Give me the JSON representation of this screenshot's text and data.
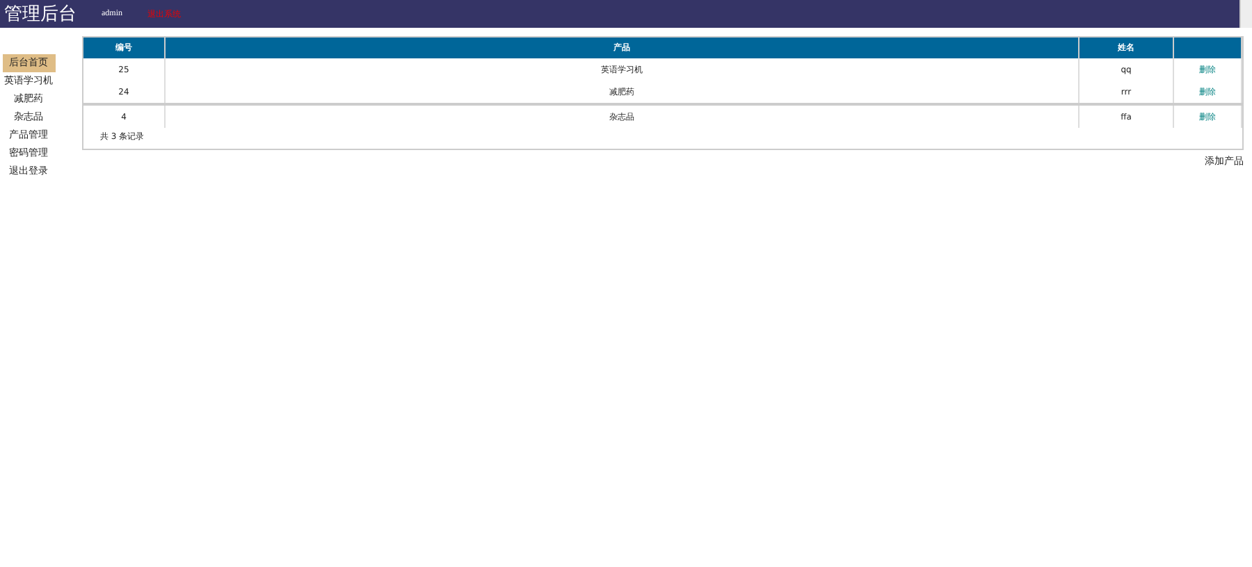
{
  "header": {
    "title": "管理后台",
    "user": "admin",
    "logout": "退出系统"
  },
  "sidebar": {
    "items": [
      {
        "label": "后台首页",
        "selected": true
      },
      {
        "label": "英语学习机",
        "selected": false
      },
      {
        "label": "减肥药",
        "selected": false
      },
      {
        "label": "杂志品",
        "selected": false
      },
      {
        "label": "产品管理",
        "selected": false
      },
      {
        "label": "密码管理",
        "selected": false
      },
      {
        "label": "退出登录",
        "selected": false
      }
    ]
  },
  "table": {
    "columns": [
      "编号",
      "产品",
      "姓名"
    ],
    "rows": [
      {
        "id": "25",
        "product": "英语学习机",
        "name": "qq",
        "action": "删除"
      },
      {
        "id": "24",
        "product": "减肥药",
        "name": "rrr",
        "action": "删除"
      },
      {
        "id": "4",
        "product": "杂志品",
        "name": "ffa",
        "action": "删除"
      }
    ],
    "footer": "共 3 条记录"
  },
  "add_link": "添加产品"
}
